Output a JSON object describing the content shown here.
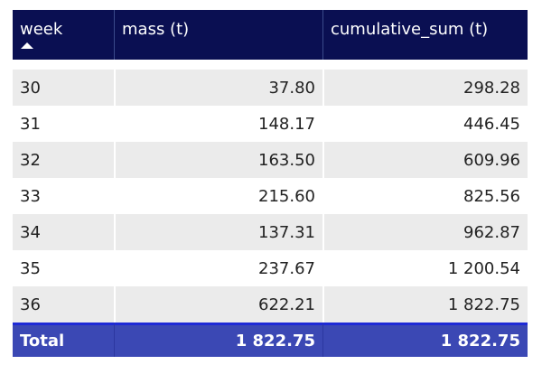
{
  "chart_data": {
    "type": "table",
    "columns": [
      "week",
      "mass (t)",
      "cumulative_sum (t)"
    ],
    "sorted_column": "week",
    "sort_direction": "ascending",
    "rows": [
      {
        "week": "30",
        "mass": "37.80",
        "cumulative_sum": "298.28"
      },
      {
        "week": "31",
        "mass": "148.17",
        "cumulative_sum": "446.45"
      },
      {
        "week": "32",
        "mass": "163.50",
        "cumulative_sum": "609.96"
      },
      {
        "week": "33",
        "mass": "215.60",
        "cumulative_sum": "825.56"
      },
      {
        "week": "34",
        "mass": "137.31",
        "cumulative_sum": "962.87"
      },
      {
        "week": "35",
        "mass": "237.67",
        "cumulative_sum": "1 200.54"
      },
      {
        "week": "36",
        "mass": "622.21",
        "cumulative_sum": "1 822.75"
      }
    ],
    "total": {
      "label": "Total",
      "mass": "1 822.75",
      "cumulative_sum": "1 822.75"
    }
  },
  "colors": {
    "header_bg": "#0a0f52",
    "total_bg": "#3b48b4",
    "row_shade": "#ebebeb",
    "text": "#222222"
  },
  "icons": {
    "sort": "sort-ascending-icon"
  }
}
